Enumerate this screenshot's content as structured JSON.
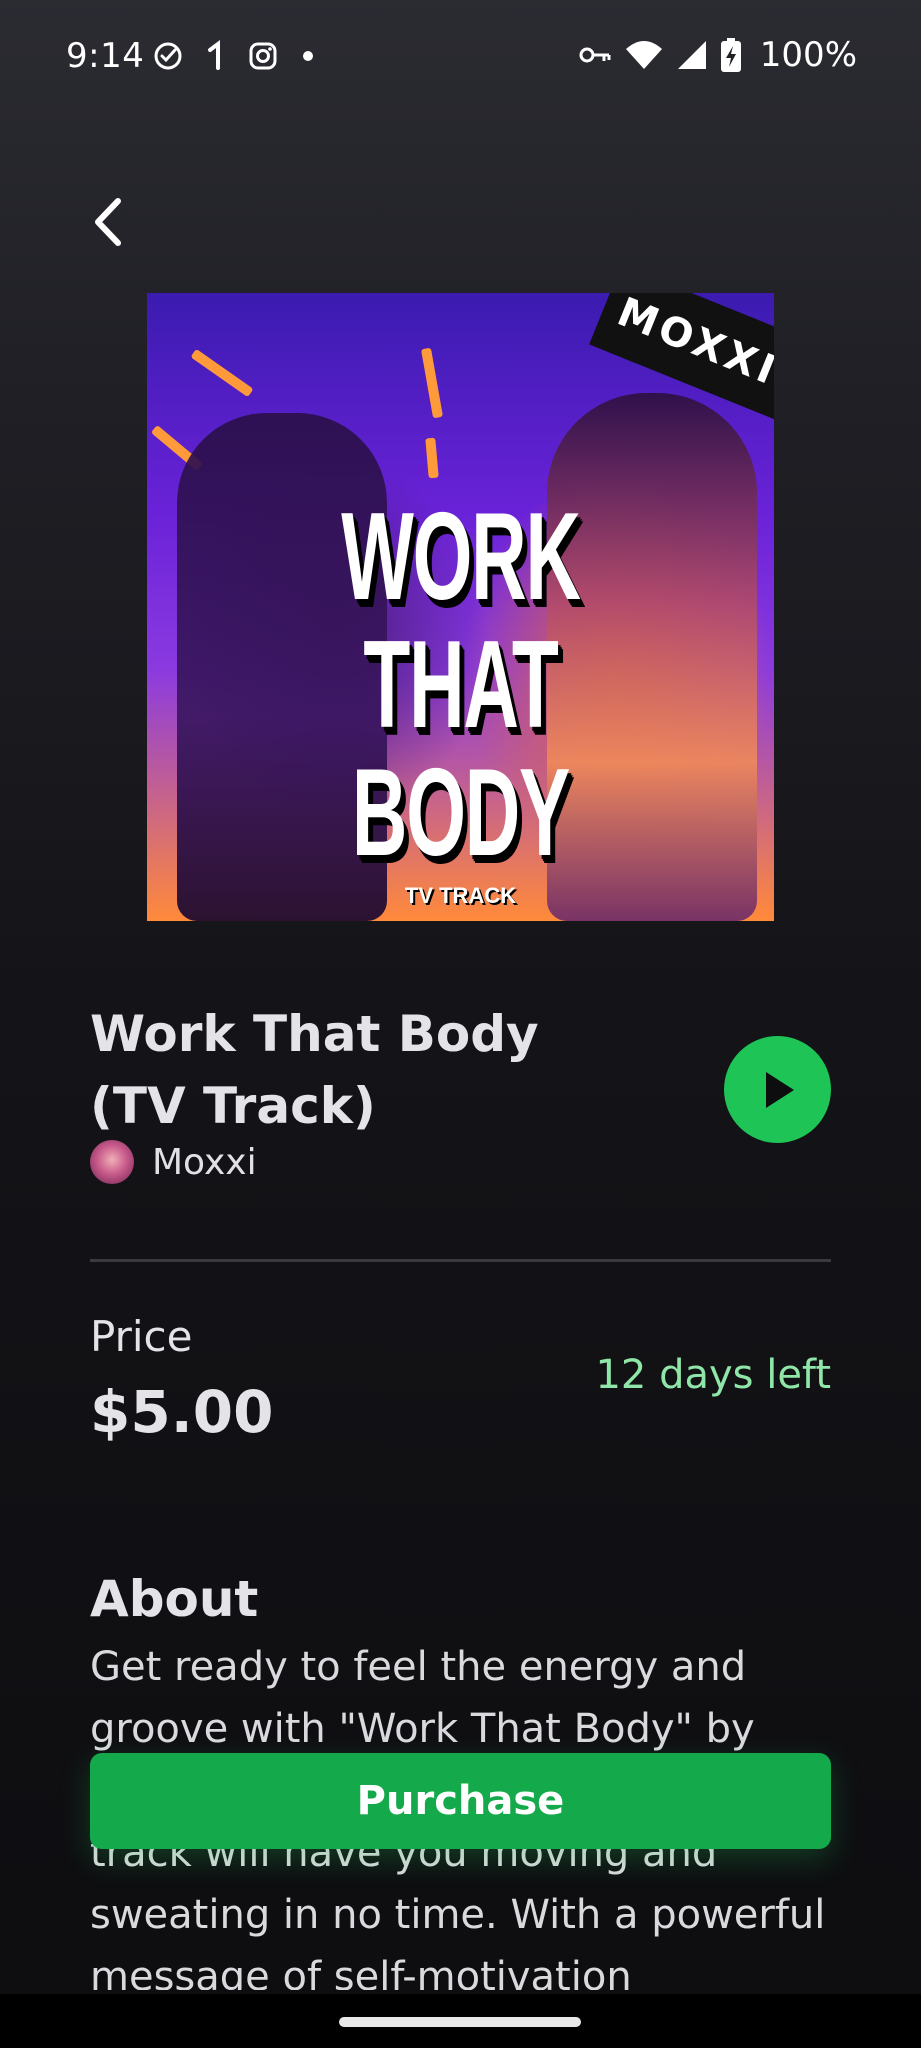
{
  "status_bar": {
    "time": "9:14",
    "battery": "100%",
    "left_icons": [
      "check-circle-icon",
      "notification-1-icon",
      "instagram-icon",
      "dot-icon"
    ],
    "right_icons": [
      "vpn-key-icon",
      "wifi-icon",
      "cell-signal-icon",
      "battery-charging-icon"
    ]
  },
  "cover": {
    "badge": "MOXXI",
    "title_lines": [
      "WORK",
      "THAT",
      "BODY"
    ],
    "subtitle": "TV TRACK"
  },
  "track": {
    "title": "Work That Body (TV Track)",
    "artist": "Moxxi"
  },
  "price": {
    "label": "Price",
    "value": "$5.00",
    "time_left": "12 days left"
  },
  "about": {
    "heading": "About",
    "text": "Get ready to feel the energy and groove with \"Work That Body\" by Moxxi! This high-energy hip hop/rap track will have you moving and sweating in no time. With a powerful message of self-motivation"
  },
  "actions": {
    "purchase_label": "Purchase"
  },
  "colors": {
    "accent_green": "#1ec556",
    "purchase_green": "#14a94a",
    "days_left_green": "#8fe6a8"
  }
}
